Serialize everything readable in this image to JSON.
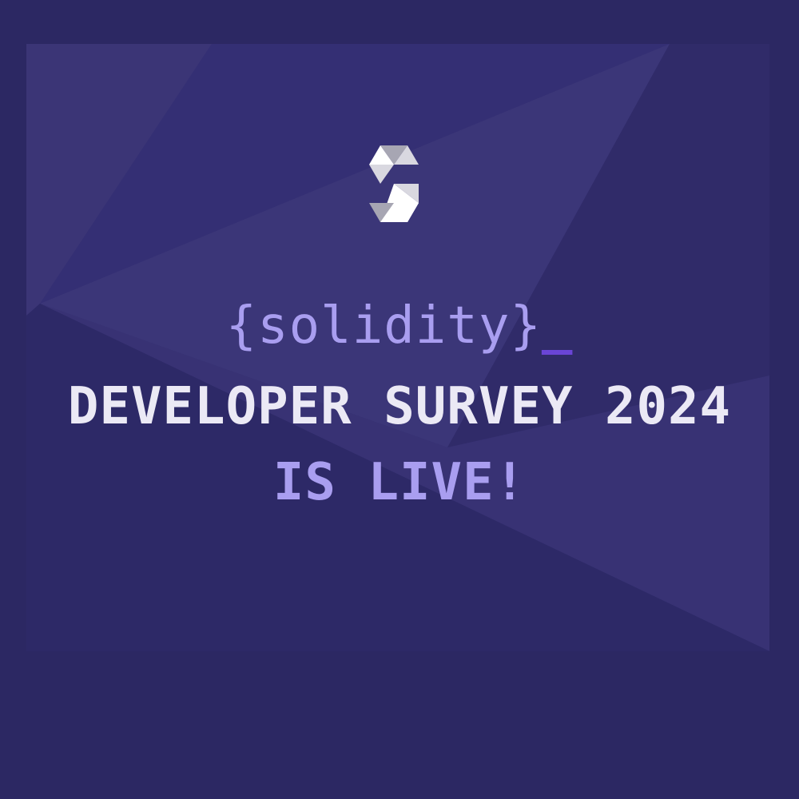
{
  "logo": {
    "icon": "solidity-logo-icon",
    "fill_light": "#ffffff",
    "fill_mid": "#d9d8e0",
    "fill_dark": "#a7a6b3"
  },
  "headline": {
    "brand_text": "{solidity}",
    "cursor": "_",
    "survey_text": "DEVELOPER SURVEY 2024",
    "live_text": "IS LIVE!"
  },
  "colors": {
    "background": "#2c2863",
    "brand_purple": "#a99ef0",
    "cursor_purple": "#6a45d6",
    "headline_white": "#ebe9f5"
  }
}
